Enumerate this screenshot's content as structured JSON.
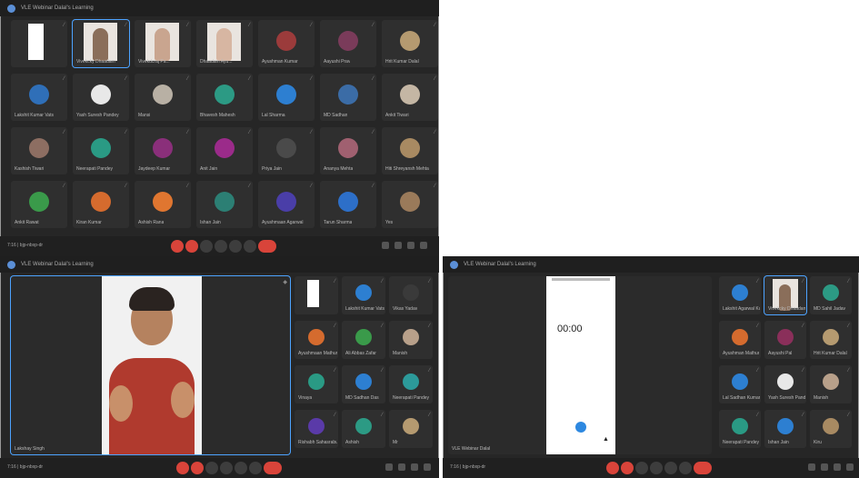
{
  "windows": {
    "top": {
      "title": "VLE Webinar Dalal's Learning",
      "bottom_left": "7:16  |  bjp-nbxp-dr",
      "tiles": [
        {
          "name": "",
          "color": "#ffffff",
          "kind": "white"
        },
        {
          "name": "Vivekcky Dhaadam",
          "color": "#8a6e5a",
          "kind": "video",
          "active": true
        },
        {
          "name": "Vivekdcraj Pa...",
          "color": "#c9a58f",
          "kind": "video"
        },
        {
          "name": "Dhaadam Ayu...",
          "color": "#d7b6a2",
          "kind": "video"
        },
        {
          "name": "Ayushman Kumar",
          "color": "#9b3b3b",
          "kind": "avatar"
        },
        {
          "name": "Aayushi Prav",
          "color": "#7a3b5a",
          "kind": "avatar"
        },
        {
          "name": "Hrit Kumar Dalal",
          "color": "#b59a70",
          "kind": "photo"
        },
        {
          "name": "Lakshit Kumar Vats",
          "color": "#2f6fb8",
          "kind": "avatar"
        },
        {
          "name": "Yash Suresh Pandey",
          "color": "#e8e8e8",
          "kind": "avatar"
        },
        {
          "name": "Mansi",
          "color": "#b8b0a4",
          "kind": "photo"
        },
        {
          "name": "Bhavesh Mahesh",
          "color": "#2c9a84",
          "kind": "avatar"
        },
        {
          "name": "Lal Sharma",
          "color": "#2d7fd1",
          "kind": "avatar"
        },
        {
          "name": "MD Sadhan",
          "color": "#3b6ca6",
          "kind": "avatar"
        },
        {
          "name": "Ankit Tiwari",
          "color": "#c4b6a4",
          "kind": "photo"
        },
        {
          "name": "Kashish Tiwari",
          "color": "#8d6e62",
          "kind": "photo"
        },
        {
          "name": "Neerapati Pandey",
          "color": "#2a9a84",
          "kind": "avatar"
        },
        {
          "name": "Jaydeep Kumar",
          "color": "#8a2f7a",
          "kind": "avatar"
        },
        {
          "name": "Anit Jain",
          "color": "#9b2b8a",
          "kind": "avatar"
        },
        {
          "name": "Priya Jain",
          "color": "#4a4a4a",
          "kind": "photo"
        },
        {
          "name": "Ananya Mehta",
          "color": "#a06070",
          "kind": "photo"
        },
        {
          "name": "Hiti Shreyansh Mehta",
          "color": "#a88a62",
          "kind": "photo"
        },
        {
          "name": "Ankit Rawat",
          "color": "#3a9a4a",
          "kind": "avatar"
        },
        {
          "name": "Kiran Kumar",
          "color": "#d56b2e",
          "kind": "avatar"
        },
        {
          "name": "Ashish Rana",
          "color": "#e07630",
          "kind": "avatar"
        },
        {
          "name": "Ishan Jain",
          "color": "#2c7f74",
          "kind": "avatar"
        },
        {
          "name": "Ayushmaan Agarwal",
          "color": "#4a3ea8",
          "kind": "avatar"
        },
        {
          "name": "Tarun Sharma",
          "color": "#2d6fc8",
          "kind": "avatar"
        },
        {
          "name": "Yes",
          "color": "#9a7a5a",
          "kind": "photo"
        }
      ]
    },
    "bottom_left": {
      "title": "VLE Webinar Dalal's Learning",
      "speaker_label": "Lakshay Singh",
      "bottom_left": "7:16  |  bjp-nbxp-dr",
      "tiles": [
        {
          "name": "",
          "color": "#ffffff",
          "kind": "white"
        },
        {
          "name": "Lakshit Kumar Vats",
          "color": "#2d7fd1",
          "kind": "avatar"
        },
        {
          "name": "Vikas Yadav",
          "color": "#3a3a3a",
          "kind": "photo"
        },
        {
          "name": "Ayushmaan Mathur",
          "color": "#d56b2e",
          "kind": "avatar"
        },
        {
          "name": "Ali Abbas Zafar",
          "color": "#3a9a4a",
          "kind": "avatar"
        },
        {
          "name": "Manish",
          "color": "#b8a08a",
          "kind": "photo"
        },
        {
          "name": "Vinaya",
          "color": "#2a9a84",
          "kind": "avatar"
        },
        {
          "name": "MD Sadhan Das",
          "color": "#2d7fd1",
          "kind": "avatar"
        },
        {
          "name": "Neerapati Pandey",
          "color": "#2c9a9a",
          "kind": "avatar"
        },
        {
          "name": "Rishabh Sahasrabuddhe",
          "color": "#5a3aa8",
          "kind": "avatar"
        },
        {
          "name": "Ashish",
          "color": "#2c9a84",
          "kind": "avatar"
        },
        {
          "name": "Mr",
          "color": "#b59a70",
          "kind": "photo"
        }
      ]
    },
    "bottom_right": {
      "title": "VLE Webinar Dalal's Learning",
      "timer": "00:00",
      "bottom_left": "7:16  |  bjp-nbxp-dr",
      "caption": "VLE Webinar Dalal",
      "tiles": [
        {
          "name": "Lakshit Agarwal Kumar",
          "color": "#2d7fd1",
          "kind": "avatar"
        },
        {
          "name": "Vivekcky Dhaadam",
          "color": "#8a6e5a",
          "kind": "video",
          "active": true
        },
        {
          "name": "MD Sahil Jadav",
          "color": "#2c9a84",
          "kind": "avatar"
        },
        {
          "name": "Ayushman Mathur",
          "color": "#d56b2e",
          "kind": "avatar"
        },
        {
          "name": "Aayushi Pal",
          "color": "#8a2f5a",
          "kind": "avatar"
        },
        {
          "name": "Hrit Kumar Dalal",
          "color": "#b59a70",
          "kind": "photo"
        },
        {
          "name": "Lal Sadhan Kumar",
          "color": "#2d7fd1",
          "kind": "avatar"
        },
        {
          "name": "Yash Suresh Pandey",
          "color": "#e8e8e8",
          "kind": "avatar"
        },
        {
          "name": "Manish",
          "color": "#b8a08a",
          "kind": "photo"
        },
        {
          "name": "Neerapati Pandey",
          "color": "#2a9a84",
          "kind": "avatar"
        },
        {
          "name": "Ishan Jain",
          "color": "#2d7fd1",
          "kind": "avatar"
        },
        {
          "name": "Kiru",
          "color": "#a88a62",
          "kind": "photo"
        }
      ]
    }
  },
  "colors": {
    "accent": "#4da3ff",
    "end_call": "#d9443a"
  }
}
